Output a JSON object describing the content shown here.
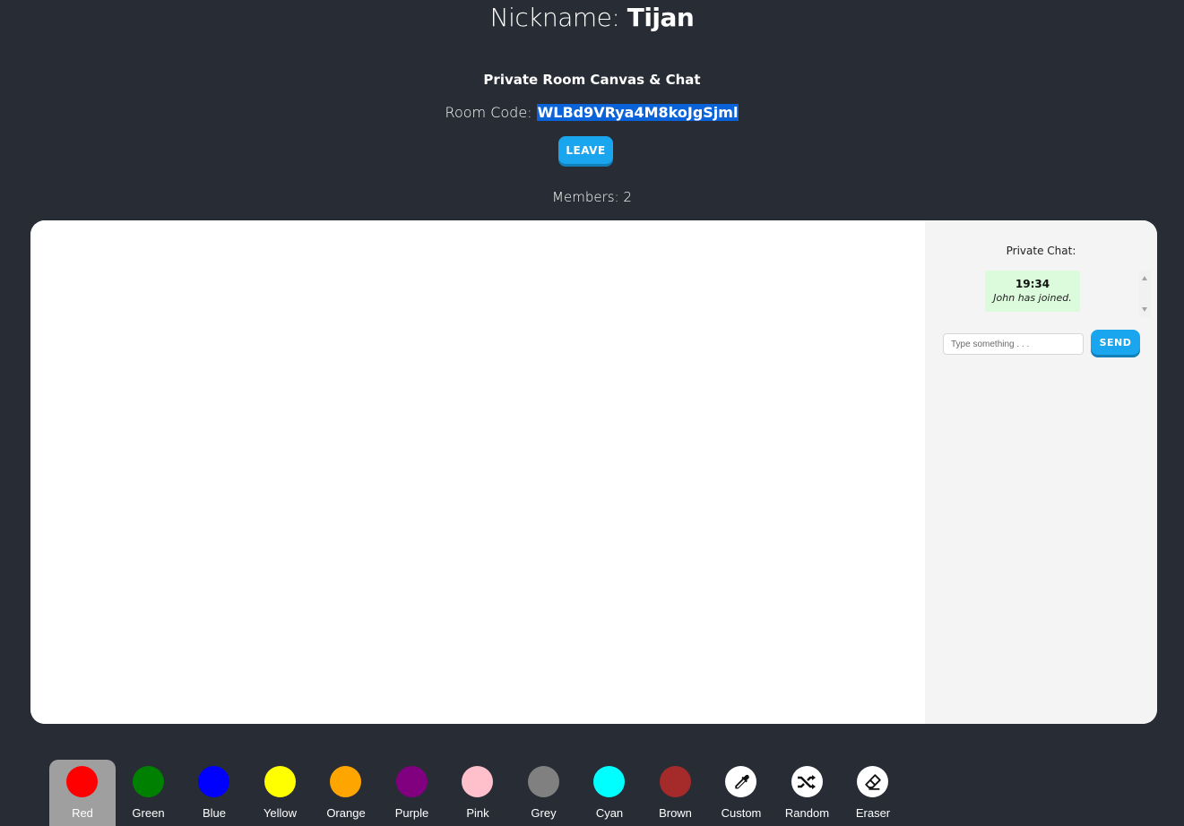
{
  "header": {
    "nickname_label": "Nickname:",
    "nickname": "Tijan",
    "room_title": "Private Room Canvas & Chat",
    "room_code_label": "Room Code:",
    "room_code": "WLBd9VRya4M8koJgSjml",
    "leave_label": "LEAVE",
    "members_label": "Members: 2"
  },
  "chat": {
    "title": "Private Chat:",
    "messages": [
      {
        "time": "19:34",
        "text": "John has joined."
      }
    ],
    "input_placeholder": "Type something . . .",
    "send_label": "SEND"
  },
  "palette": {
    "selected": "Red",
    "colors": [
      {
        "label": "Red",
        "hex": "#ff0000"
      },
      {
        "label": "Green",
        "hex": "#008000"
      },
      {
        "label": "Blue",
        "hex": "#0000ff"
      },
      {
        "label": "Yellow",
        "hex": "#ffff00"
      },
      {
        "label": "Orange",
        "hex": "#ffa500"
      },
      {
        "label": "Purple",
        "hex": "#800080"
      },
      {
        "label": "Pink",
        "hex": "#ffc0cb"
      },
      {
        "label": "Grey",
        "hex": "#808080"
      },
      {
        "label": "Cyan",
        "hex": "#00ffff"
      },
      {
        "label": "Brown",
        "hex": "#a52a2a"
      }
    ],
    "tools": [
      {
        "label": "Custom",
        "icon": "eyedropper-icon"
      },
      {
        "label": "Random",
        "icon": "shuffle-icon"
      },
      {
        "label": "Eraser",
        "icon": "eraser-icon"
      }
    ]
  },
  "colors": {
    "background": "#282c35",
    "accent": "#1aa6ee",
    "chat_panel": "#f4f4f4",
    "message_bubble": "#dcfbdc",
    "selected_swatch": "#9f9f9f",
    "code_highlight": "#0b63d9"
  }
}
